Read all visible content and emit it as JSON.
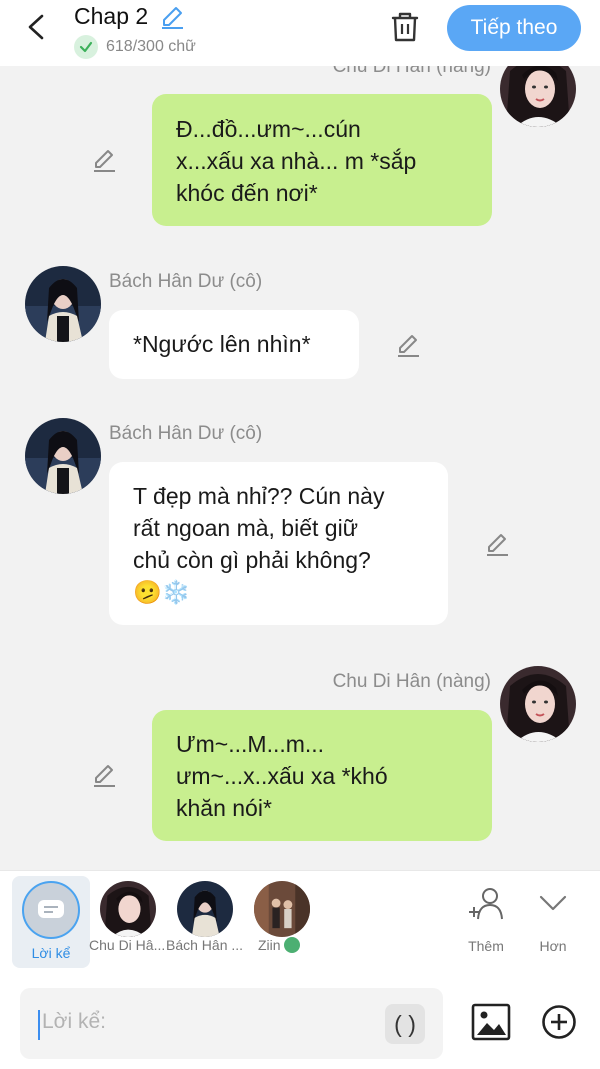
{
  "header": {
    "title": "Chap 2",
    "word_count": "618/300 chữ",
    "next_label": "Tiếp theo",
    "accent_color": "#5aa7f5"
  },
  "messages": [
    {
      "sender": "Chu Di Hân (nàng)",
      "side": "right",
      "bubble_color": "#c8ef8f",
      "lines": [
        "Đ...đồ...ưm~...cún",
        "x...xấu xa nhà... m *sắp",
        "khóc đến nơi*"
      ]
    },
    {
      "sender": "Bách Hân Dư (cô)",
      "side": "left",
      "bubble_color": "#ffffff",
      "lines": [
        "*Ngước lên nhìn*"
      ]
    },
    {
      "sender": "Bách Hân Dư (cô)",
      "side": "left",
      "bubble_color": "#ffffff",
      "lines": [
        "T đẹp mà nhỉ?? Cún này",
        "rất ngoan mà, biết giữ",
        "chủ còn gì phải không?",
        "🫤❄️"
      ]
    },
    {
      "sender": "Chu Di Hân (nàng)",
      "side": "right",
      "bubble_color": "#c8ef8f",
      "lines": [
        "Ưm~...M...m...",
        "ưm~...x..xấu xa *khó",
        "khăn nói*"
      ]
    }
  ],
  "character_bar": {
    "narrator_label": "Lời kể",
    "characters": [
      {
        "name": "Chu Di Hâ...",
        "icon": "avatar-woman-white"
      },
      {
        "name": "Bách Hân ...",
        "icon": "avatar-woman-dark"
      },
      {
        "name": "Ziin",
        "icon": "avatar-couple"
      }
    ],
    "add_label": "Thêm",
    "more_label": "Hơn"
  },
  "input": {
    "placeholder": "Lời kể:",
    "paren_label": "( )"
  }
}
